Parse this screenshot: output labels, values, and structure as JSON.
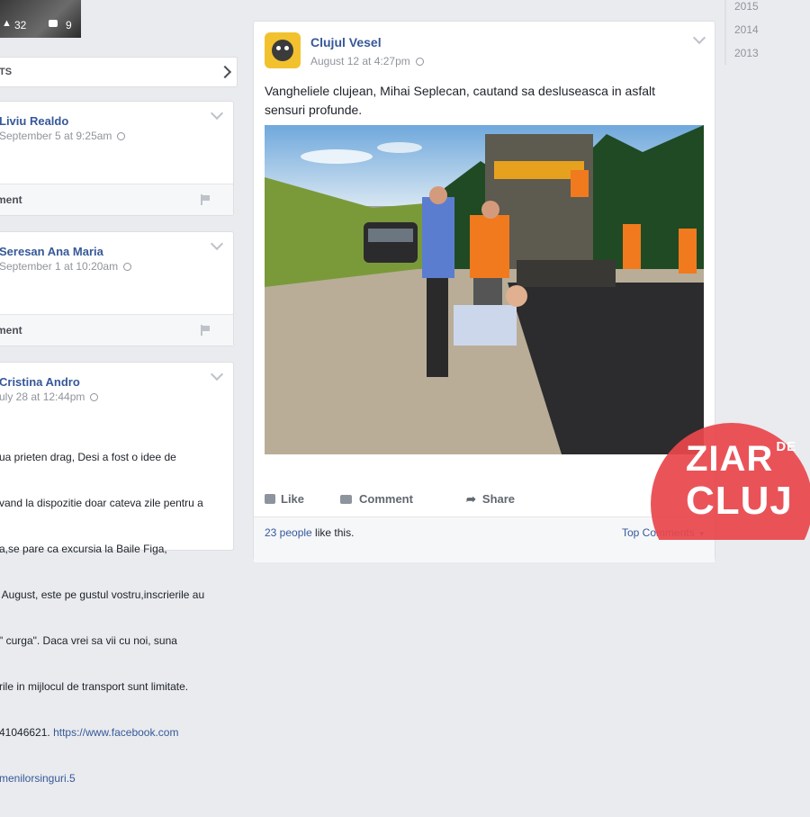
{
  "left_column": {
    "photo_strip": {
      "likes": "32",
      "comments": "9"
    },
    "section_header": {
      "title": "TS"
    },
    "posts": [
      {
        "author": "Liviu Realdo",
        "time": "September 5 at 9:25am",
        "comment_label": "ment"
      },
      {
        "author": "Seresan Ana Maria",
        "time": "September 1 at 10:20am",
        "comment_label": "ment"
      },
      {
        "author": "Cristina Andro",
        "time": "uly 28 at 12:44pm",
        "text_lines": [
          "ua prieten drag, Desi a fost o idee de",
          "vand la dispozitie doar cateva zile pentru a",
          "a,se pare ca excursia la Baile Figa,",
          " August, este pe gustul vostru,inscrierile au",
          "\" curga\". Daca vrei sa vii cu noi, suna",
          "rile in mijlocul de transport sunt limitate.",
          "41046621."
        ],
        "link_text": "https://www.facebook.com",
        "link_text2": "menilorsinguri.5"
      }
    ]
  },
  "main_post": {
    "page_name": "Clujul Vesel",
    "timestamp": "August 12 at 4:27pm",
    "text": "Vangheliele clujean, Mihai Seplecan, cautand sa desluseasca in asfalt sensuri profunde.",
    "actions": {
      "like": "Like",
      "comment": "Comment",
      "share": "Share"
    },
    "likes_count": "23 people",
    "likes_suffix": " like this.",
    "top_comments": "Top Comments"
  },
  "timeline_years": [
    "2015",
    "2014",
    "2013"
  ],
  "watermark": {
    "line1": "ZIAR",
    "sup": "DE",
    "line2": "CLUJ",
    "color": "#e8474c"
  }
}
